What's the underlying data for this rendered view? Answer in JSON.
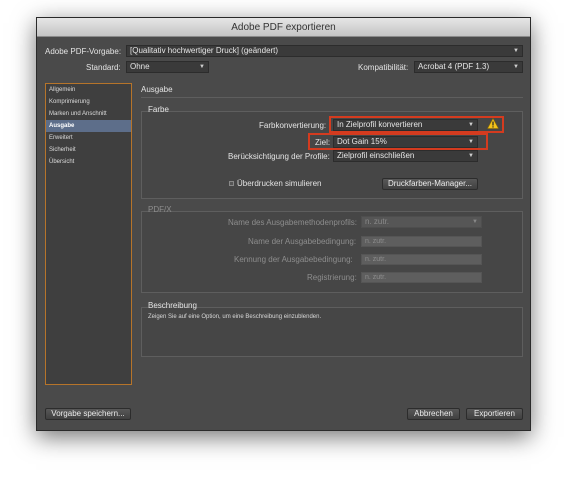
{
  "window": {
    "title": "Adobe PDF exportieren"
  },
  "top": {
    "preset_label": "Adobe PDF-Vorgabe:",
    "preset_value": "[Qualitativ hochwertiger Druck] (geändert)",
    "standard_label": "Standard:",
    "standard_value": "Ohne",
    "compat_label": "Kompatibilität:",
    "compat_value": "Acrobat 4 (PDF 1.3)"
  },
  "sidebar": {
    "items": [
      {
        "label": "Allgemein"
      },
      {
        "label": "Komprimierung"
      },
      {
        "label": "Marken und Anschnitt"
      },
      {
        "label": "Ausgabe"
      },
      {
        "label": "Erweitert"
      },
      {
        "label": "Sicherheit"
      },
      {
        "label": "Übersicht"
      }
    ],
    "active_index": 3
  },
  "main": {
    "section_title": "Ausgabe",
    "farbe": {
      "title": "Farbe",
      "conversion_label": "Farbkonvertierung:",
      "conversion_value": "In Zielprofil konvertieren",
      "target_label": "Ziel:",
      "target_value": "Dot Gain 15%",
      "profile_label": "Berücksichtigung der Profile:",
      "profile_value": "Zielprofil einschließen",
      "overprint_label": "Überdrucken simulieren",
      "ink_manager_label": "Druckfarben-Manager..."
    },
    "pdfx": {
      "title": "PDF/X",
      "output_profile_label": "Name des Ausgabemethodenprofils:",
      "output_profile_value": "n. zutr.",
      "condition_name_label": "Name der Ausgabebedingung:",
      "condition_name_value": "n. zutr.",
      "condition_id_label": "Kennung der Ausgabebedingung:",
      "condition_id_value": "n. zutr.",
      "registry_label": "Registrierung:",
      "registry_value": "n. zutr."
    },
    "description": {
      "title": "Beschreibung",
      "text": "Zeigen Sie auf eine Option, um eine Beschreibung einzublenden."
    }
  },
  "footer": {
    "save_preset_label": "Vorgabe speichern...",
    "cancel_label": "Abbrechen",
    "export_label": "Exportieren"
  },
  "colors": {
    "highlight_border": "#d43b1f",
    "sidebar_border": "#b6742a",
    "warning_fill": "#f3c21b"
  },
  "icons": {
    "warning": "warning-icon",
    "dropdown": "chevron-down-icon"
  }
}
